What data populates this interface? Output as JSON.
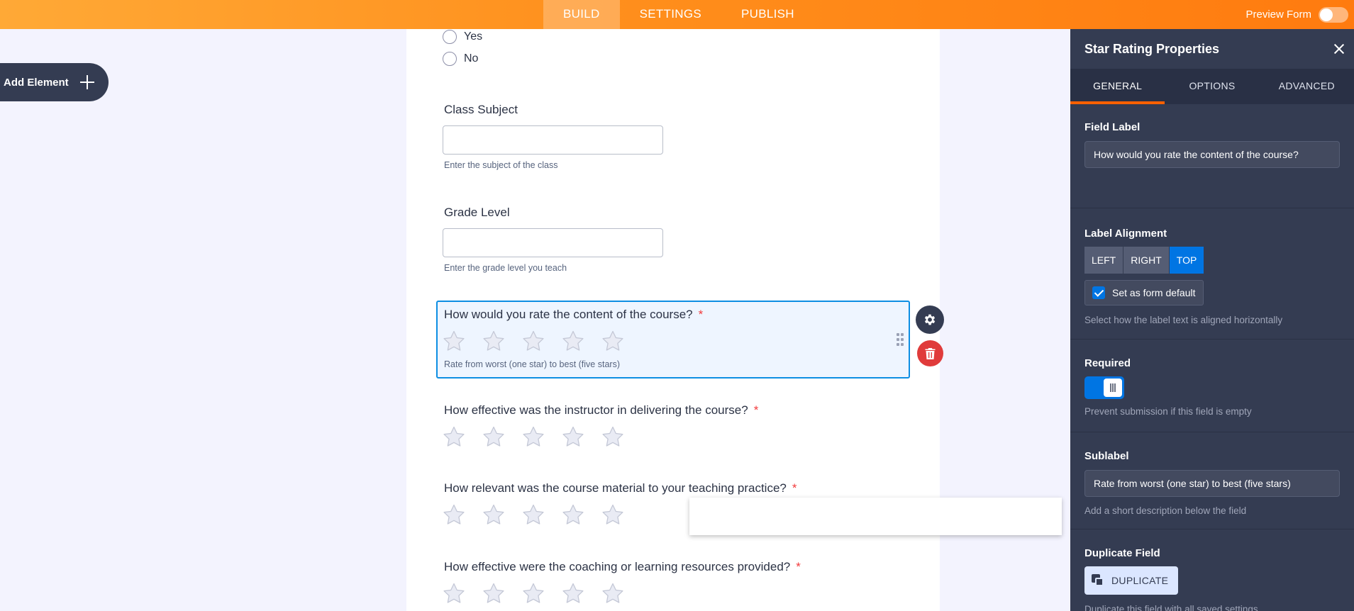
{
  "topbar": {
    "tabs": [
      "BUILD",
      "SETTINGS",
      "PUBLISH"
    ],
    "active_tab": "BUILD",
    "preview_label": "Preview Form",
    "preview_enabled": false
  },
  "add_element": {
    "label": "Add Element"
  },
  "form": {
    "radio_options": [
      "Yes",
      "No"
    ],
    "fields": [
      {
        "label": "Class Subject",
        "sublabel": "Enter the subject of the class",
        "value": ""
      },
      {
        "label": "Grade Level",
        "sublabel": "Enter the grade level you teach",
        "value": ""
      }
    ],
    "rating_questions": [
      {
        "label": "How would you rate the content of the course?",
        "required_mark": "*",
        "sublabel": "Rate from worst (one star) to best (five stars)",
        "stars": 5,
        "rating": 0,
        "selected": true
      },
      {
        "label": "How effective was the instructor in delivering the course?",
        "required_mark": "*",
        "stars": 5,
        "rating": 0
      },
      {
        "label": "How relevant was the course material to your teaching practice?",
        "required_mark": "*",
        "stars": 5,
        "rating": 0
      },
      {
        "label": "How effective were the coaching or learning resources provided?",
        "required_mark": "*",
        "stars": 5,
        "rating": 0
      }
    ]
  },
  "panel": {
    "title": "Star Rating Properties",
    "tabs": [
      "GENERAL",
      "OPTIONS",
      "ADVANCED"
    ],
    "active_tab": "GENERAL",
    "field_label": {
      "title": "Field Label",
      "value": "How would you rate the content of the course?"
    },
    "label_alignment": {
      "title": "Label Alignment",
      "options": [
        "LEFT",
        "RIGHT",
        "TOP"
      ],
      "selected": "TOP",
      "default_checkbox": "Set as form default",
      "default_checked": true,
      "description": "Select how the label text is aligned horizontally"
    },
    "required": {
      "title": "Required",
      "enabled": true,
      "description": "Prevent submission if this field is empty"
    },
    "sublabel": {
      "title": "Sublabel",
      "value": "Rate from worst (one star) to best (five stars)",
      "description": "Add a short description below the field"
    },
    "duplicate": {
      "title": "Duplicate Field",
      "button": "DUPLICATE",
      "description": "Duplicate this field with all saved settings"
    }
  },
  "colors": {
    "accent": "#ff7b0f",
    "panel_bg": "#343c52",
    "selection": "#0d8ee3",
    "primary_button": "#0075e3",
    "required_mark": "#f23a3c"
  }
}
